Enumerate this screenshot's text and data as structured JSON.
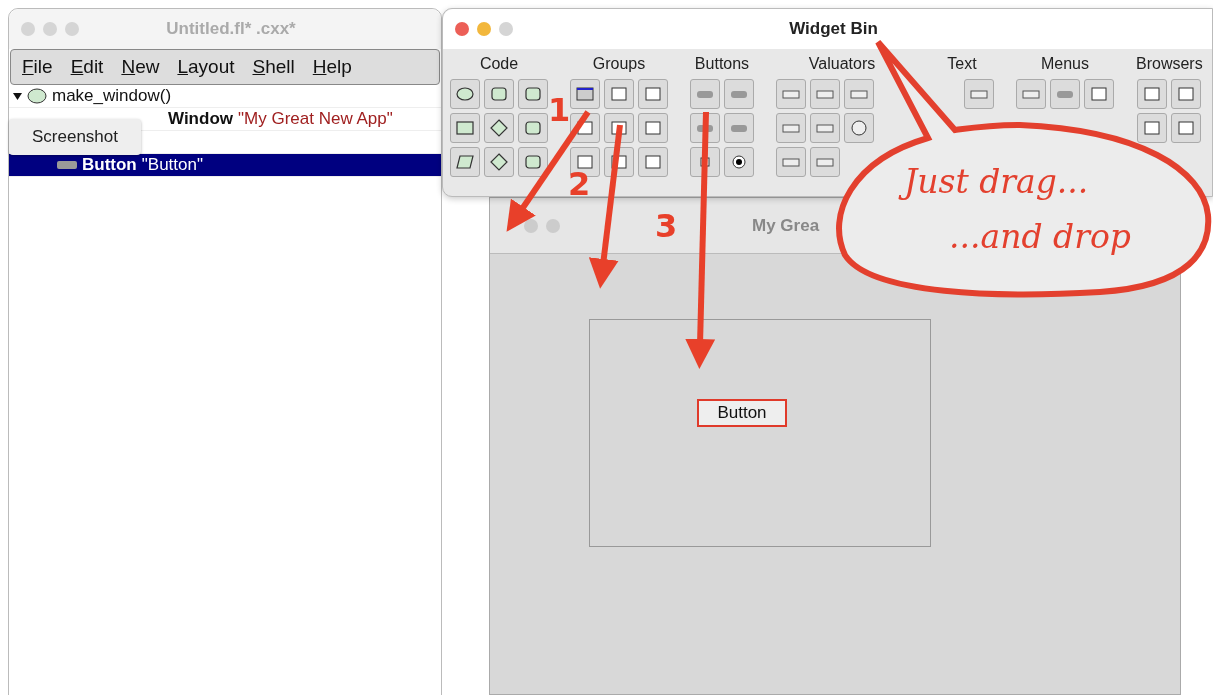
{
  "project_window": {
    "title": "Untitled.fl*  .cxx*",
    "menu": [
      "File",
      "Edit",
      "New",
      "Layout",
      "Shell",
      "Help"
    ],
    "tree": [
      {
        "kind": "function",
        "label": "make_window()",
        "expanded": true,
        "selected": false,
        "children": [
          {
            "kind": "window",
            "label": "Window",
            "value": "\"My Great New App\"",
            "selected": false
          },
          {
            "kind": "group",
            "selected": false
          },
          {
            "kind": "button",
            "label": "Button",
            "value": "\"Button\"",
            "selected": true
          }
        ]
      }
    ],
    "tooltip": "Screenshot"
  },
  "widget_bin": {
    "title": "Widget Bin",
    "groups": [
      {
        "label": "Code",
        "tools": [
          {
            "kind": "oval"
          },
          {
            "kind": "tab"
          },
          {
            "kind": "comment"
          },
          {
            "kind": "rect"
          },
          {
            "kind": "diamond"
          },
          {
            "kind": "class"
          },
          {
            "kind": "para"
          },
          {
            "kind": "hash"
          },
          {
            "kind": "data"
          }
        ]
      },
      {
        "label": "Groups",
        "tools": [
          {
            "kind": "window"
          },
          {
            "kind": "frame"
          },
          {
            "kind": "lines"
          },
          {
            "kind": "tabs"
          },
          {
            "kind": "grid2"
          },
          {
            "kind": "stack"
          },
          {
            "kind": "flex"
          },
          {
            "kind": "scroll"
          },
          {
            "kind": "table"
          }
        ]
      },
      {
        "label": "Buttons",
        "tools": [
          {
            "kind": "pill"
          },
          {
            "kind": "pill"
          },
          {
            "kind": "pill"
          },
          {
            "kind": "dots"
          },
          {
            "kind": "check"
          },
          {
            "kind": "radio"
          }
        ]
      },
      {
        "label": "Valuators",
        "tools": [
          {
            "kind": "slider"
          },
          {
            "kind": "slider"
          },
          {
            "kind": "slider"
          },
          {
            "kind": "covered"
          },
          {
            "kind": "slider"
          },
          {
            "kind": "slider"
          },
          {
            "kind": "dial"
          },
          {
            "kind": "covered"
          },
          {
            "kind": "slider"
          },
          {
            "kind": "slider"
          },
          {
            "kind": "covered"
          },
          {
            "kind": "covered"
          }
        ]
      },
      {
        "label": "Text",
        "tools": [
          {
            "kind": "covered"
          },
          {
            "kind": "field"
          },
          {
            "kind": "covered"
          },
          {
            "kind": "covered"
          },
          {
            "kind": "covered"
          },
          {
            "kind": "covered"
          }
        ]
      },
      {
        "label": "Menus",
        "tools": [
          {
            "kind": "choice"
          },
          {
            "kind": "pill"
          },
          {
            "kind": "frame"
          },
          {
            "kind": "covered"
          },
          {
            "kind": "covered"
          },
          {
            "kind": "covered"
          },
          {
            "kind": "covered"
          },
          {
            "kind": "covered"
          },
          {
            "kind": "covered"
          }
        ]
      },
      {
        "label": "Browsers",
        "tools": [
          {
            "kind": "frame"
          },
          {
            "kind": "frame"
          },
          {
            "kind": "frame"
          },
          {
            "kind": "frame"
          },
          {
            "kind": "covered"
          },
          {
            "kind": "covered"
          }
        ]
      }
    ]
  },
  "app_window": {
    "title": "My Grea",
    "button": "Button"
  },
  "annotations": {
    "steps": [
      "1",
      "2",
      "3"
    ],
    "bubble": [
      "Just drag...",
      "...and drop"
    ]
  }
}
